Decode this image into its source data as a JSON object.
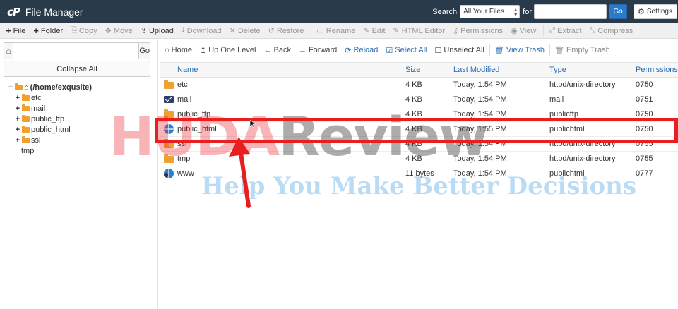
{
  "header": {
    "app_title": "File Manager",
    "logo_text": "cP",
    "search_label": "Search",
    "search_scope": "All Your Files",
    "for_label": "for",
    "search_value": "",
    "go_label": "Go",
    "settings_label": "Settings"
  },
  "toolbar": {
    "items": [
      {
        "label": "File",
        "icon": "plus-icon",
        "glyph": "+",
        "enabled": true
      },
      {
        "label": "Folder",
        "icon": "plus-icon",
        "glyph": "+",
        "enabled": true
      },
      {
        "label": "Copy",
        "icon": "copy-icon",
        "glyph": "⎘",
        "enabled": false
      },
      {
        "label": "Move",
        "icon": "move-icon",
        "glyph": "✥",
        "enabled": false
      },
      {
        "label": "Upload",
        "icon": "upload-icon",
        "glyph": "⇪",
        "enabled": true
      },
      {
        "label": "Download",
        "icon": "download-icon",
        "glyph": "⤓",
        "enabled": false
      },
      {
        "label": "Delete",
        "icon": "delete-icon",
        "glyph": "✕",
        "enabled": false
      },
      {
        "label": "Restore",
        "icon": "restore-icon",
        "glyph": "↺",
        "enabled": false
      },
      {
        "label": "Rename",
        "icon": "rename-icon",
        "glyph": "▭",
        "enabled": false
      },
      {
        "label": "Edit",
        "icon": "pencil-icon",
        "glyph": "✎",
        "enabled": false
      },
      {
        "label": "HTML Editor",
        "icon": "html-editor-icon",
        "glyph": "✎",
        "enabled": false
      },
      {
        "label": "Permissions",
        "icon": "key-icon",
        "glyph": "⚷",
        "enabled": false
      },
      {
        "label": "View",
        "icon": "eye-icon",
        "glyph": "◉",
        "enabled": false
      },
      {
        "label": "Extract",
        "icon": "extract-icon",
        "glyph": "⤢",
        "enabled": false
      },
      {
        "label": "Compress",
        "icon": "compress-icon",
        "glyph": "⤡",
        "enabled": false
      }
    ]
  },
  "left": {
    "path_value": "",
    "go_label": "Go",
    "collapse_label": "Collapse All",
    "root_label": "(/home/exqusite)",
    "tree": [
      {
        "label": "etc",
        "expand": "+"
      },
      {
        "label": "mail",
        "expand": "+"
      },
      {
        "label": "public_ftp",
        "expand": "+"
      },
      {
        "label": "public_html",
        "expand": "+"
      },
      {
        "label": "ssl",
        "expand": "+"
      },
      {
        "label": "tmp",
        "expand": ""
      }
    ]
  },
  "subtoolbar": {
    "items": [
      {
        "label": "Home",
        "icon": "home-icon",
        "glyph": "⌂",
        "style": "normal"
      },
      {
        "label": "Up One Level",
        "icon": "level-up-icon",
        "glyph": "↥",
        "style": "normal"
      },
      {
        "label": "Back",
        "icon": "back-arrow-icon",
        "glyph": "←",
        "style": "normal"
      },
      {
        "label": "Forward",
        "icon": "forward-arrow-icon",
        "glyph": "→",
        "style": "normal"
      },
      {
        "label": "Reload",
        "icon": "reload-icon",
        "glyph": "⟳",
        "style": "blue"
      },
      {
        "label": "Select All",
        "icon": "checkbox-checked-icon",
        "glyph": "☑",
        "style": "blue"
      },
      {
        "label": "Unselect All",
        "icon": "checkbox-empty-icon",
        "glyph": "☐",
        "style": "normal"
      },
      {
        "label": "View Trash",
        "icon": "trash-icon",
        "glyph": "🗑",
        "style": "blue"
      },
      {
        "label": "Empty Trash",
        "icon": "trash-icon",
        "glyph": "🗑",
        "style": "gray"
      }
    ]
  },
  "table": {
    "columns": {
      "name": "Name",
      "size": "Size",
      "modified": "Last Modified",
      "type": "Type",
      "permissions": "Permissions"
    },
    "rows": [
      {
        "icon": "folder",
        "name": "etc",
        "size": "4 KB",
        "modified": "Today, 1:54 PM",
        "type": "httpd/unix-directory",
        "permissions": "0750"
      },
      {
        "icon": "mail",
        "name": "mail",
        "size": "4 KB",
        "modified": "Today, 1:54 PM",
        "type": "mail",
        "permissions": "0751"
      },
      {
        "icon": "folder",
        "name": "public_ftp",
        "size": "4 KB",
        "modified": "Today, 1:54 PM",
        "type": "publicftp",
        "permissions": "0750"
      },
      {
        "icon": "globe",
        "name": "public_html",
        "size": "4 KB",
        "modified": "Today, 1:55 PM",
        "type": "publichtml",
        "permissions": "0750"
      },
      {
        "icon": "folder",
        "name": "ssl",
        "size": "4 KB",
        "modified": "Today, 1:54 PM",
        "type": "httpd/unix-directory",
        "permissions": "0755"
      },
      {
        "icon": "folder",
        "name": "tmp",
        "size": "4 KB",
        "modified": "Today, 1:54 PM",
        "type": "httpd/unix-directory",
        "permissions": "0755"
      },
      {
        "icon": "globe-link",
        "name": "www",
        "size": "11 bytes",
        "modified": "Today, 1:54 PM",
        "type": "publichtml",
        "permissions": "0777"
      }
    ]
  },
  "overlay": {
    "watermark_part1": "HUDA",
    "watermark_part2": "Review",
    "tagline": "Help You Make Better Decisions",
    "highlight_color": "#e81f1f"
  }
}
